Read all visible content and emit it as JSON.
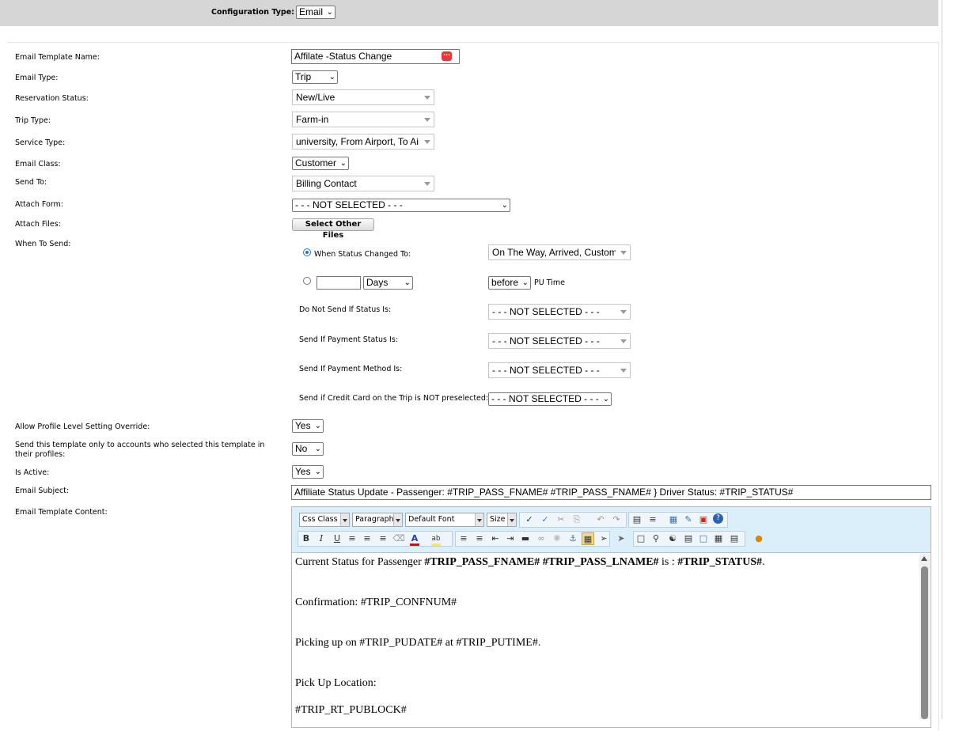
{
  "config": {
    "label": "Configuration Type:",
    "value": "Email"
  },
  "form": {
    "template_name_label": "Email Template Name:",
    "template_name_value": "Affilate -Status Change",
    "email_type_label": "Email Type:",
    "email_type_value": "Trip",
    "reservation_status_label": "Reservation Status:",
    "reservation_status_value": "New/Live",
    "trip_type_label": "Trip Type:",
    "trip_type_value": "Farm-in",
    "service_type_label": "Service Type:",
    "service_type_value": "university, From Airport, To Airport",
    "email_class_label": "Email Class:",
    "email_class_value": "Customer",
    "send_to_label": "Send To:",
    "send_to_value": "Billing Contact",
    "attach_form_label": "Attach Form:",
    "attach_form_value": "- - - NOT SELECTED - - -",
    "attach_files_label": "Attach Files:",
    "attach_files_button": "Select Other Files",
    "when_to_send_label": "When To Send:",
    "status_changed_label": "When Status Changed To:",
    "status_changed_value": "On The Way, Arrived, Customer",
    "days_value": "",
    "days_unit": "Days",
    "before_value": "before",
    "pu_time": "PU Time",
    "not_send_label": "Do Not Send If Status Is:",
    "not_send_value": "- - - NOT SELECTED - - -",
    "payment_status_label": "Send If Payment Status Is:",
    "payment_status_value": "- - - NOT SELECTED - - -",
    "payment_method_label": "Send If Payment Method Is:",
    "payment_method_value": "- - - NOT SELECTED - - -",
    "credit_card_label": "Send if Credit Card on the Trip is NOT preselected:",
    "credit_card_value": "- - - NOT SELECTED - - -",
    "override_label": "Allow Profile Level Setting Override:",
    "override_value": "Yes",
    "only_accounts_label": "Send this template only to accounts who selected this template in their profiles:",
    "only_accounts_value": "No",
    "is_active_label": "Is Active:",
    "is_active_value": "Yes",
    "subject_label": "Email Subject:",
    "subject_value": "Affiliate Status Update - Passenger: #TRIP_PASS_FNAME# #TRIP_PASS_FNAME# } Driver Status: #TRIP_STATUS#",
    "content_label": "Email Template Content:"
  },
  "editor": {
    "css_class": "Css Class",
    "paragraph": "Paragraph",
    "font": "Default Font",
    "size": "Size",
    "line1_pre": "Current Status for Passenger ",
    "line1_b1": "#TRIP_PASS_FNAME# #TRIP_PASS_LNAME#",
    "line1_mid": " is : ",
    "line1_b2": "#TRIP_STATUS#",
    "line1_post": ".",
    "line2": "Confirmation: #TRIP_CONFNUM#",
    "line3": "Picking up on #TRIP_PUDATE# at #TRIP_PUTIME#.",
    "line4": "Pick Up Location:",
    "line5": "#TRIP_RT_PUBLOCK#"
  },
  "colors": {
    "toolbar_bg": "#dbeffa",
    "radio_accent": "#1a73e8",
    "template_icon": "#e53935"
  }
}
